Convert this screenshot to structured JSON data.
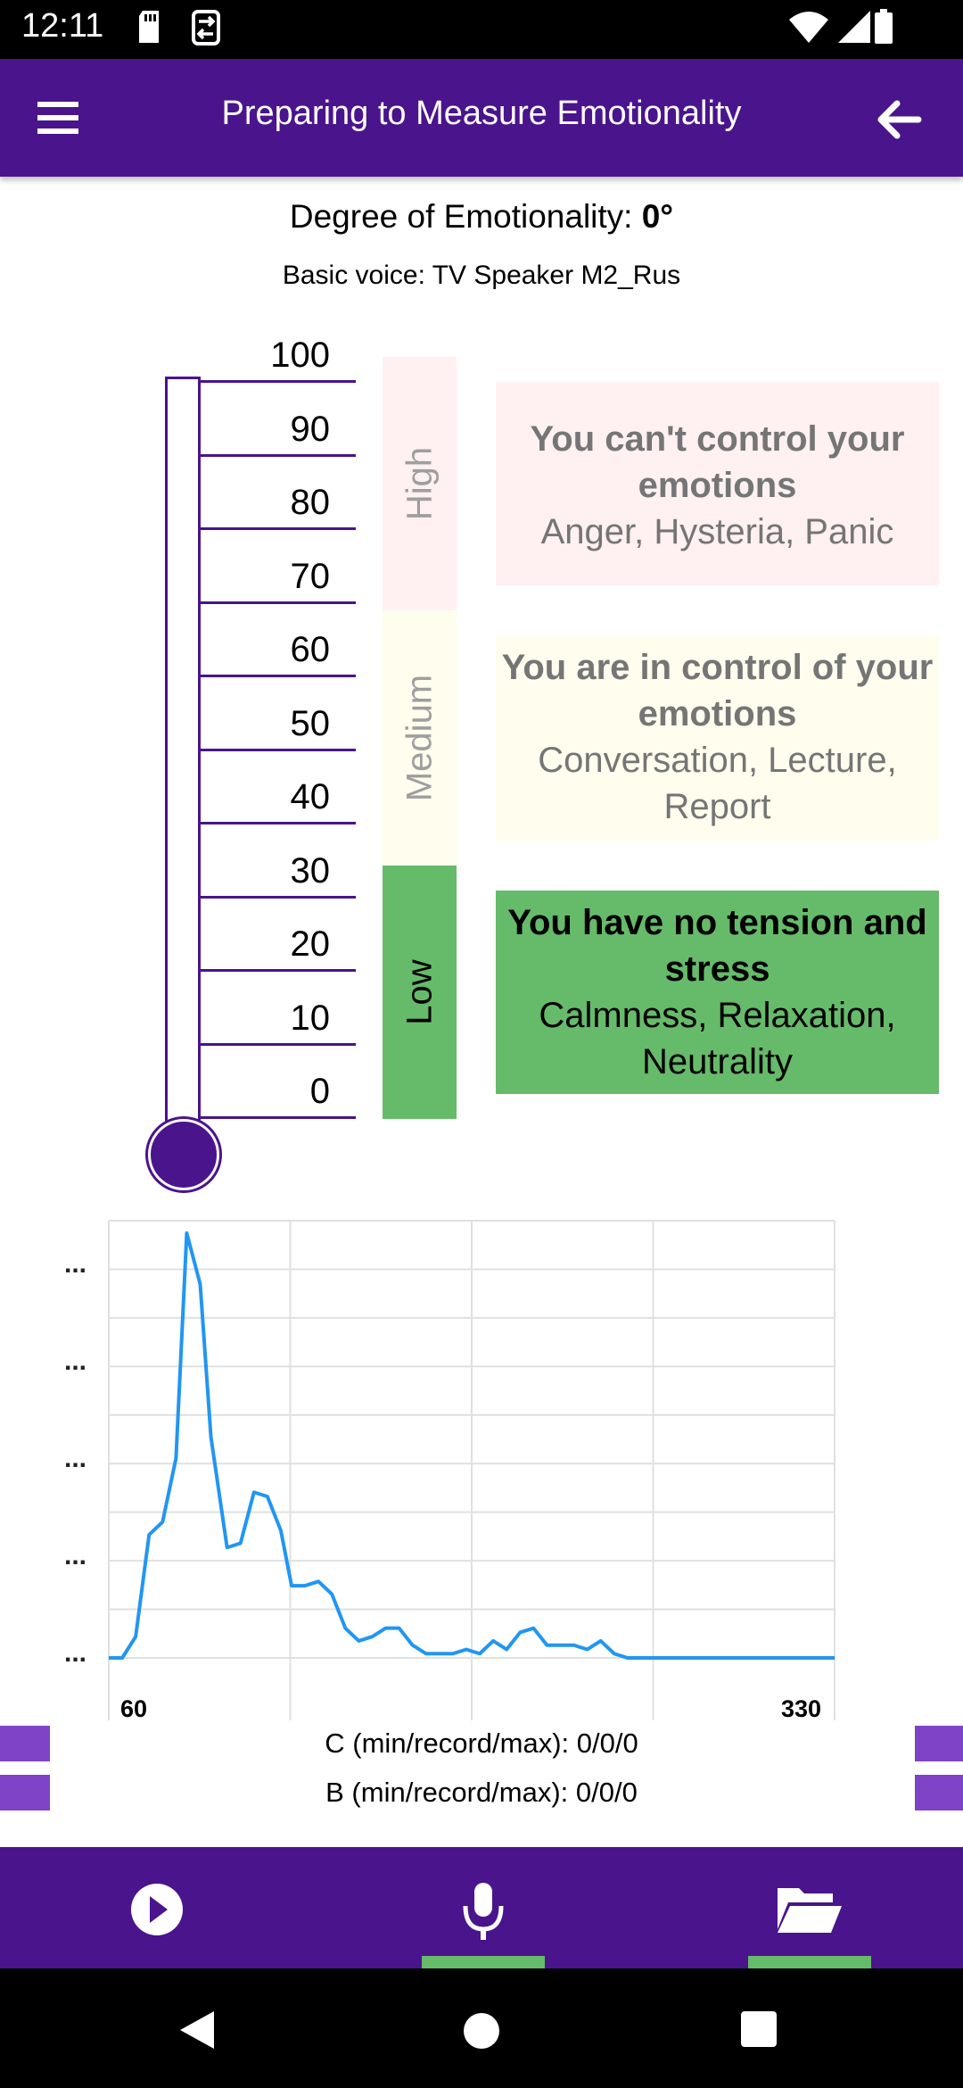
{
  "status_bar": {
    "time": "12:11",
    "icons": [
      "sd-card-icon",
      "sync-icon",
      "wifi-icon",
      "signal-icon",
      "battery-icon"
    ]
  },
  "app_bar": {
    "title": "Preparing to Measure Emotionality",
    "menu_icon": "menu-icon",
    "back_icon": "arrow-back-icon",
    "color": "#4a148c"
  },
  "degree": {
    "label": "Degree of Emotionality: ",
    "value": "0°"
  },
  "basic_voice": "Basic voice: TV Speaker M2_Rus",
  "thermometer": {
    "scale": [
      "100",
      "90",
      "80",
      "70",
      "60",
      "50",
      "40",
      "30",
      "20",
      "10",
      "0"
    ],
    "level": 0
  },
  "zones": {
    "high": {
      "label": "High",
      "title": "You can't control your emotions",
      "examples": "Anger, Hysteria, Panic",
      "color": "#fff0f2"
    },
    "medium": {
      "label": "Medium",
      "title": "You are in control of your emotions",
      "examples": "Conversation, Lecture, Report",
      "color": "#fffdee"
    },
    "low": {
      "label": "Low",
      "title": "You have no tension and stress",
      "examples": "Calmness, Relaxation, Neutrality",
      "color": "#66bb6a"
    }
  },
  "chart_data": {
    "type": "line",
    "x_tick_labels": [
      "60",
      "330"
    ],
    "y_tick_labels": [
      "...",
      "...",
      "...",
      "...",
      "..."
    ],
    "xlim": [
      60,
      330
    ],
    "ylim": [
      0,
      100
    ],
    "grid": true,
    "series": [
      {
        "color": "#2196f3",
        "x": [
          60,
          65,
          70,
          75,
          80,
          85,
          89,
          94,
          98,
          104,
          109,
          114,
          119,
          124,
          128,
          133,
          138,
          143,
          148,
          153,
          158,
          163,
          168,
          173,
          178,
          183,
          188,
          193,
          198,
          203,
          208,
          213,
          218,
          223,
          228,
          233,
          238,
          243,
          248,
          253,
          258,
          263,
          268,
          273,
          278,
          283,
          288,
          293,
          298,
          303,
          308,
          313,
          318,
          323,
          328,
          330
        ],
        "y": [
          0,
          0,
          5,
          29,
          32,
          47,
          100,
          88,
          52,
          26,
          27,
          39,
          38,
          30,
          17,
          17,
          18,
          15,
          7,
          4,
          5,
          7,
          7,
          3,
          1,
          1,
          1,
          2,
          1,
          4,
          2,
          6,
          7,
          3,
          3,
          3,
          2,
          4,
          1,
          0,
          0,
          0,
          0,
          0,
          0,
          0,
          0,
          0,
          0,
          0,
          0,
          0,
          0,
          0,
          0,
          0
        ]
      }
    ]
  },
  "stats": {
    "c_line": "C (min/record/max): 0/0/0",
    "b_line": "B (min/record/max): 0/0/0"
  },
  "bottom_nav": {
    "items": [
      {
        "icon": "play-icon",
        "active": false
      },
      {
        "icon": "microphone-icon",
        "active": true
      },
      {
        "icon": "folder-open-icon",
        "active": true
      }
    ],
    "indicator_color": "#66bb6a"
  },
  "system_nav": [
    "back-icon",
    "home-icon",
    "recents-icon"
  ]
}
